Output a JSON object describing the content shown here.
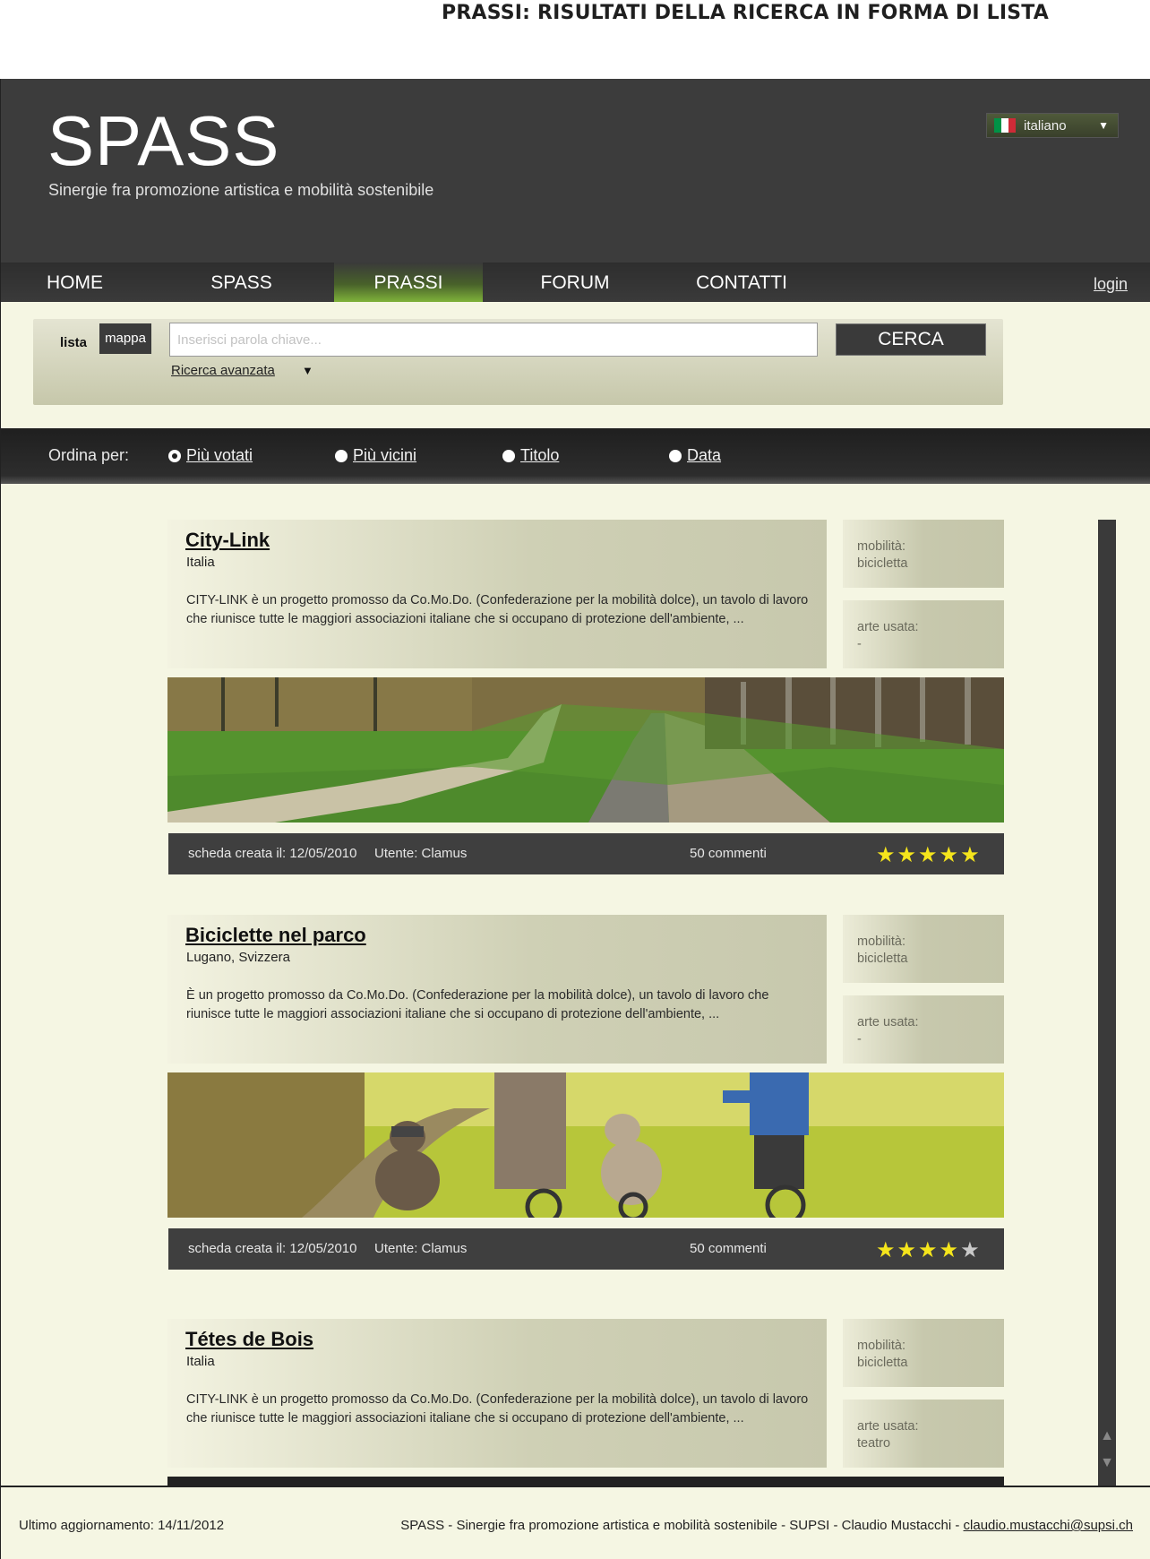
{
  "doc_title": "PRASSI: RISULTATI DELLA RICERCA IN FORMA DI LISTA",
  "header": {
    "logo": "SPASS",
    "tagline": "Sinergie fra promozione artistica e mobilità sostenibile",
    "language": "italiano",
    "flag_colors": [
      "#009246",
      "#ffffff",
      "#ce2b37"
    ]
  },
  "nav": {
    "items": [
      {
        "label": "HOME"
      },
      {
        "label": "SPASS"
      },
      {
        "label": "PRASSI",
        "active": true
      },
      {
        "label": "FORUM"
      },
      {
        "label": "CONTATTI"
      }
    ],
    "login": "login",
    "active_color": "#7fb23a"
  },
  "search": {
    "tab_lista": "lista",
    "tab_mappa": "mappa",
    "placeholder": "Inserisci parola chiave...",
    "button": "CERCA",
    "advanced": "Ricerca avanzata"
  },
  "sort": {
    "label": "Ordina per:",
    "options": [
      {
        "label": "Più votati",
        "selected": true
      },
      {
        "label": "Più vicini"
      },
      {
        "label": "Titolo"
      },
      {
        "label": "Data"
      }
    ]
  },
  "results": [
    {
      "title": "City-Link",
      "place": "Italia",
      "description": "CITY-LINK è un progetto promosso da Co.Mo.Do. (Confederazione per la mobilità dolce), un tavolo di lavoro che riunisce tutte le maggiori associazioni italiane che si occupano di protezione dell'ambiente, ...",
      "mobility_label": "mobilità:",
      "mobility_value": "bicicletta",
      "art_label": "arte usata:",
      "art_value": "-",
      "created": "scheda creata il: 12/05/2010",
      "user": "Utente: Clamus",
      "comments": "50 commenti",
      "rating": 5,
      "image": "canal-bike-path-photo"
    },
    {
      "title": "Biciclette nel parco",
      "place": "Lugano, Svizzera",
      "description": "È un progetto promosso da Co.Mo.Do. (Confederazione per la mobilità dolce), un tavolo di lavoro che riunisce tutte le maggiori associazioni italiane che si occupano di protezione dell'ambiente, ...",
      "mobility_label": "mobilità:",
      "mobility_value": "bicicletta",
      "art_label": "arte usata:",
      "art_value": "-",
      "created": "scheda creata il: 12/05/2010",
      "user": "Utente: Clamus",
      "comments": "50 commenti",
      "rating": 4,
      "image": "family-cycling-park-photo"
    },
    {
      "title": "Tétes de Bois",
      "place": "Italia",
      "description": "CITY-LINK è un progetto promosso da Co.Mo.Do. (Confederazione per la mobilità dolce), un tavolo di lavoro che riunisce tutte le maggiori associazioni italiane che si occupano di protezione dell'ambiente, ...",
      "mobility_label": "mobilità:",
      "mobility_value": "bicicletta",
      "art_label": "arte usata:",
      "art_value": "teatro"
    }
  ],
  "footer": {
    "updated": "Ultimo aggiornamento: 14/11/2012",
    "credits": "SPASS - Sinergie fra promozione artistica e mobilità sostenibile - SUPSI - Claudio Mustacchi - ",
    "email": "claudio.mustacchi@supsi.ch"
  }
}
